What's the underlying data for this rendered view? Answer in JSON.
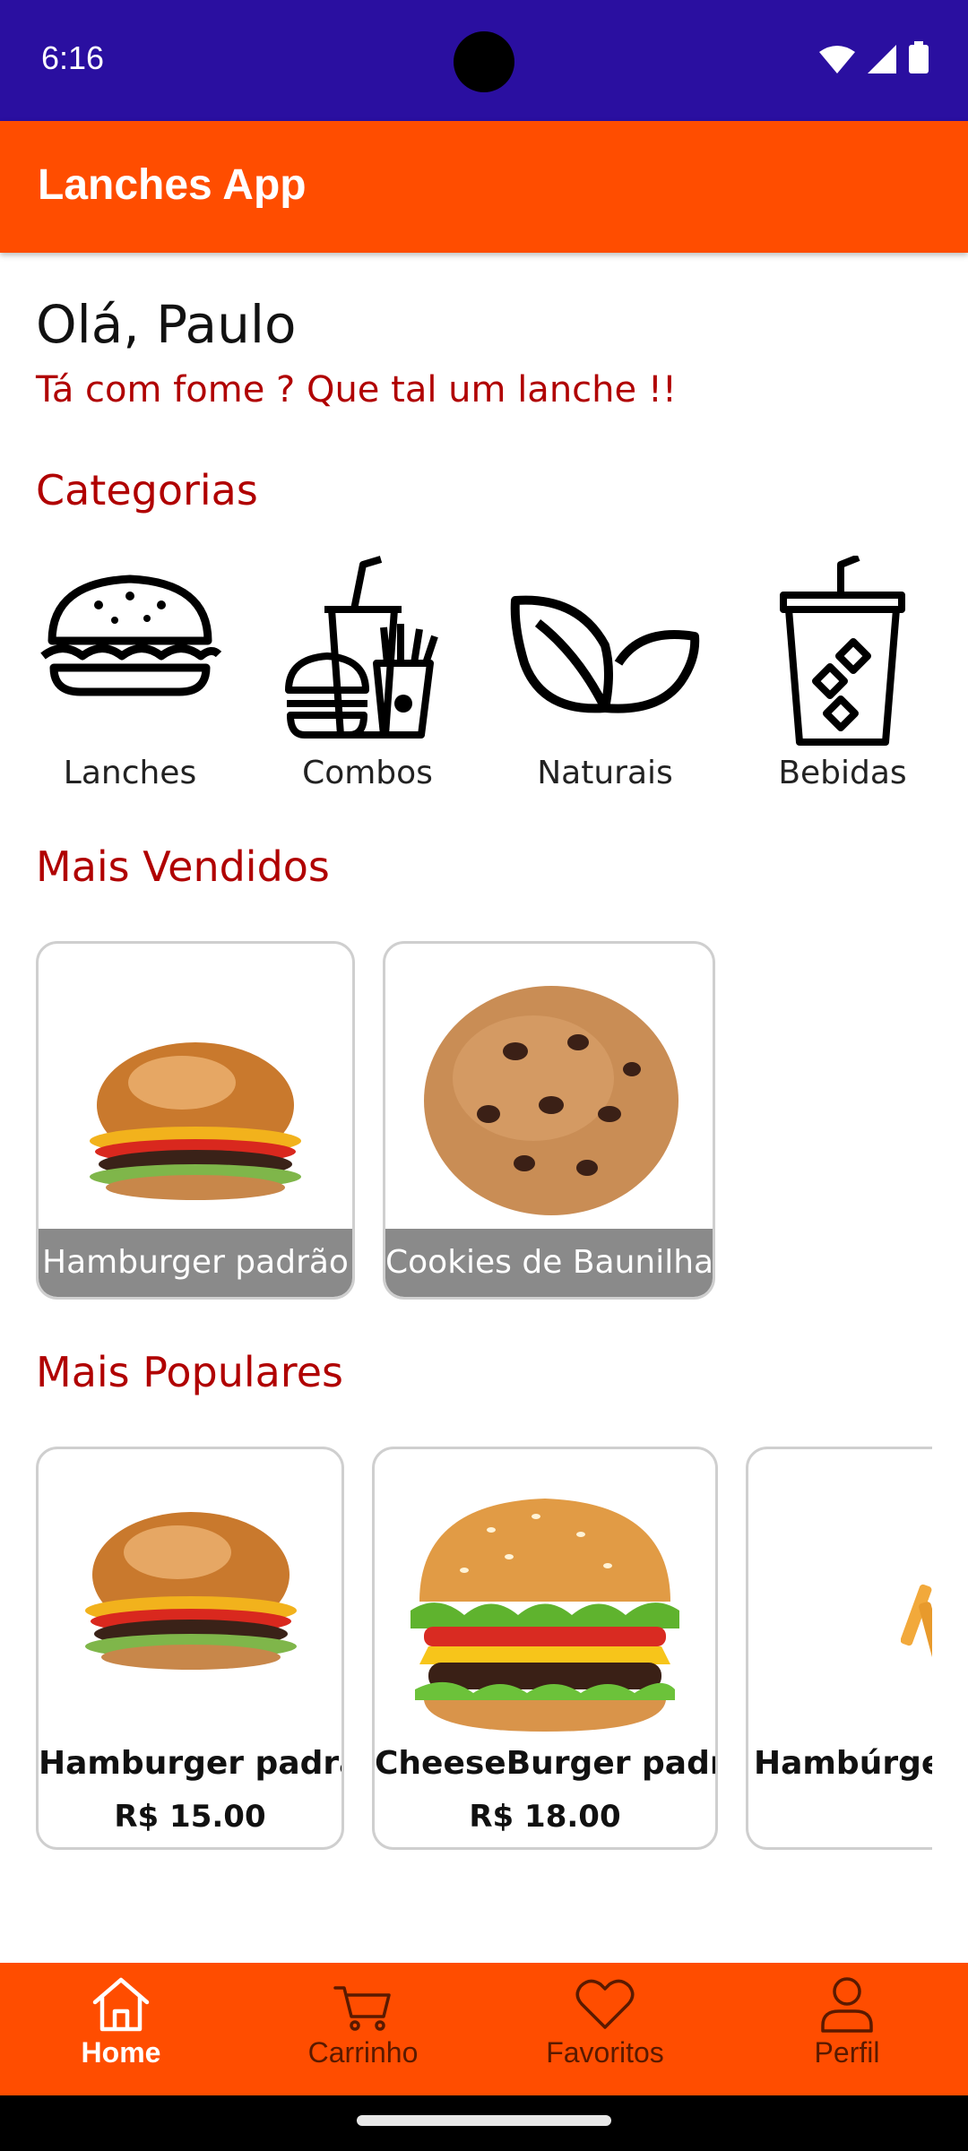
{
  "status_bar": {
    "time": "6:16",
    "icons": [
      "wifi-icon",
      "signal-icon",
      "battery-icon"
    ]
  },
  "app_bar": {
    "title": "Lanches App",
    "color": "#ff4d00"
  },
  "greeting": "Olá, Paulo",
  "subtitle": "Tá com fome ? Que tal um lanche !!",
  "sections": {
    "categories": "Categorias",
    "best_sellers": "Mais Vendidos",
    "popular": "Mais Populares"
  },
  "categories": [
    {
      "label": "Lanches",
      "icon": "burger-icon"
    },
    {
      "label": "Combos",
      "icon": "combo-meal-icon"
    },
    {
      "label": "Naturais",
      "icon": "leaf-icon"
    },
    {
      "label": "Bebidas",
      "icon": "drink-cup-icon"
    }
  ],
  "best_sellers": [
    {
      "name": "Hamburger padrão",
      "image": "hamburger-image"
    },
    {
      "name": "Cookies de Baunilha",
      "image": "cookie-image"
    }
  ],
  "popular": [
    {
      "name": "Hamburger padrão",
      "price": "R$ 15.00",
      "image": "hamburger-image"
    },
    {
      "name": "CheeseBurger padrão",
      "price": "R$ 18.00",
      "image": "cheeseburger-image"
    },
    {
      "name": "Hambúrger,",
      "price": "",
      "image": "burger-fries-image"
    }
  ],
  "bottom_nav": [
    {
      "label": "Home",
      "icon": "home-icon",
      "active": true
    },
    {
      "label": "Carrinho",
      "icon": "cart-icon",
      "active": false
    },
    {
      "label": "Favoritos",
      "icon": "heart-icon",
      "active": false
    },
    {
      "label": "Perfil",
      "icon": "person-icon",
      "active": false
    }
  ],
  "colors": {
    "primary": "#ff4d00",
    "status_bar": "#2a0fa0",
    "accent_text": "#b00000"
  }
}
